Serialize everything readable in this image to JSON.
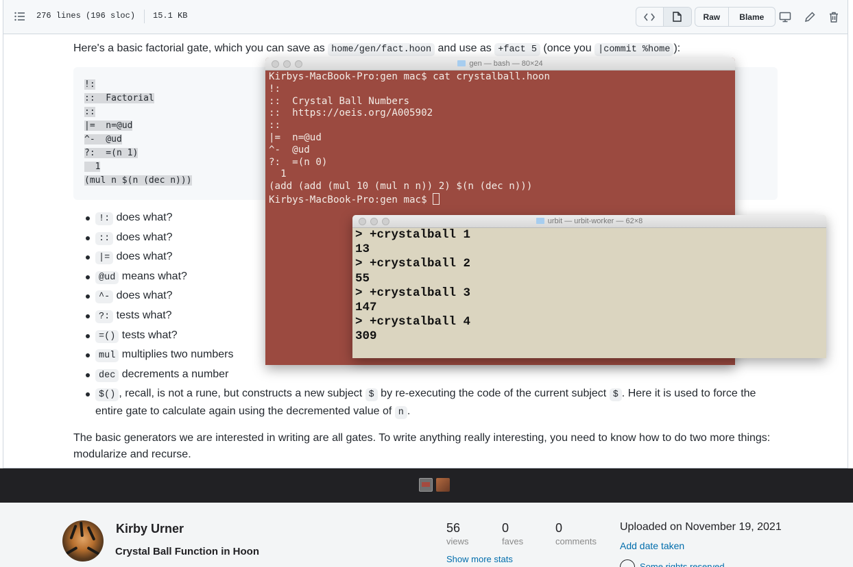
{
  "file_header": {
    "lines": "276 lines (196 sloc)",
    "size": "15.1 KB",
    "raw": "Raw",
    "blame": "Blame"
  },
  "readme": {
    "intro": {
      "p1": "Here's a basic factorial gate, which you can save as ",
      "c1": "home/gen/fact.hoon",
      "p2": " and use as ",
      "c2": "+fact 5",
      "p3": " (once you ",
      "c3": "|commit %home",
      "p4": "):"
    },
    "code_lines": [
      "!:",
      "::  Factorial",
      "::",
      "|=  n=@ud",
      "^-  @ud",
      "?:  =(n 1)",
      "  1",
      "(mul n $(n (dec n)))"
    ],
    "bullets": [
      {
        "code": "!:",
        "text": " does what?"
      },
      {
        "code": "::",
        "text": " does what?"
      },
      {
        "code": "|=",
        "text": " does what?"
      },
      {
        "code": "@ud",
        "text": " means what?"
      },
      {
        "code": "^-",
        "text": " does what?"
      },
      {
        "code": "?:",
        "text": " tests what?"
      },
      {
        "code": "=()",
        "text": " tests what?"
      },
      {
        "code": "mul",
        "text": " multiplies two numbers"
      },
      {
        "code": "dec",
        "text": " decrements a number"
      }
    ],
    "last_bullet": {
      "c1": "$()",
      "t1": ", recall, is not a rune, but constructs a new subject ",
      "c2": "$",
      "t2": " by re-executing the code of the current subject ",
      "c3": "$",
      "t3": ". Here it is used to force the entire gate to calculate again using the decremented value of ",
      "c4": "n",
      "t4": "."
    },
    "outro": "The basic generators we are interested in writing are all gates. To write anything really interesting, you need to know how to do two more things: modularize and recurse."
  },
  "gen_terminal": {
    "title": "gen — bash — 80×24",
    "lines": [
      "Kirbys-MacBook-Pro:gen mac$ cat crystalball.hoon",
      "!:",
      "::  Crystal Ball Numbers",
      "::  https://oeis.org/A005902",
      "::",
      "|=  n=@ud",
      "^-  @ud",
      "?:  =(n 0)",
      "  1",
      "(add (add (mul 10 (mul n n)) 2) $(n (dec n)))"
    ],
    "prompt": "Kirbys-MacBook-Pro:gen mac$ "
  },
  "urbit_terminal": {
    "title": "urbit — urbit-worker — 62×8",
    "lines": [
      "> +crystalball 1",
      "13",
      "> +crystalball 2",
      "55",
      "> +crystalball 3",
      "147",
      "> +crystalball 4",
      "309"
    ]
  },
  "flickr": {
    "author": "Kirby Urner",
    "photo_title": "Crystal Ball Function in Hoon",
    "views": "56",
    "views_label": "views",
    "faves": "0",
    "faves_label": "faves",
    "comments": "0",
    "comments_label": "comments",
    "more_stats": "Show more stats",
    "uploaded": "Uploaded on November 19, 2021",
    "add_date": "Add date taken",
    "rights": "Some rights reserved"
  }
}
